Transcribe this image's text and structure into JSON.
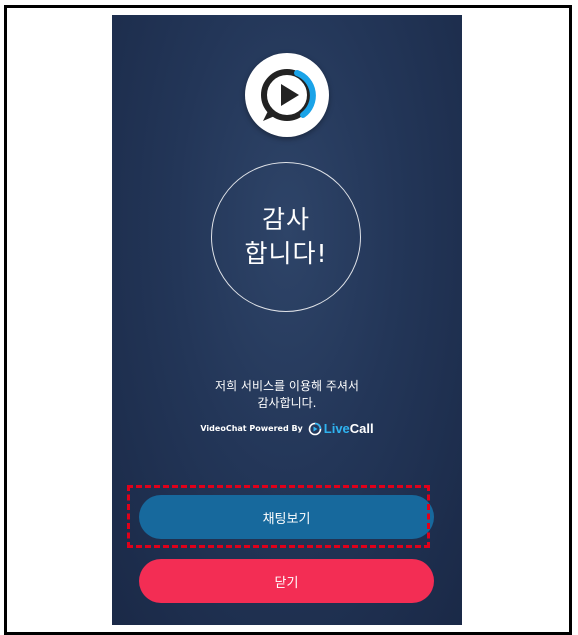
{
  "thanks": {
    "line1": "감사",
    "line2": "합니다!"
  },
  "message": {
    "line1": "저희 서비스를 이용해 주셔서",
    "line2": "감사합니다."
  },
  "powered": {
    "text": "VideoChat Powered By",
    "brand_live": "Live",
    "brand_call": "Call"
  },
  "buttons": {
    "view_chat": "채팅보기",
    "close": "닫기"
  },
  "colors": {
    "background": "#233658",
    "view_chat_button": "#17699d",
    "close_button": "#f32d54",
    "highlight": "#e0001a",
    "brand_accent": "#2fb3f0"
  },
  "icons": {
    "app_logo": "video-chat-logo-icon",
    "brand_logo": "livecall-logo-icon"
  }
}
